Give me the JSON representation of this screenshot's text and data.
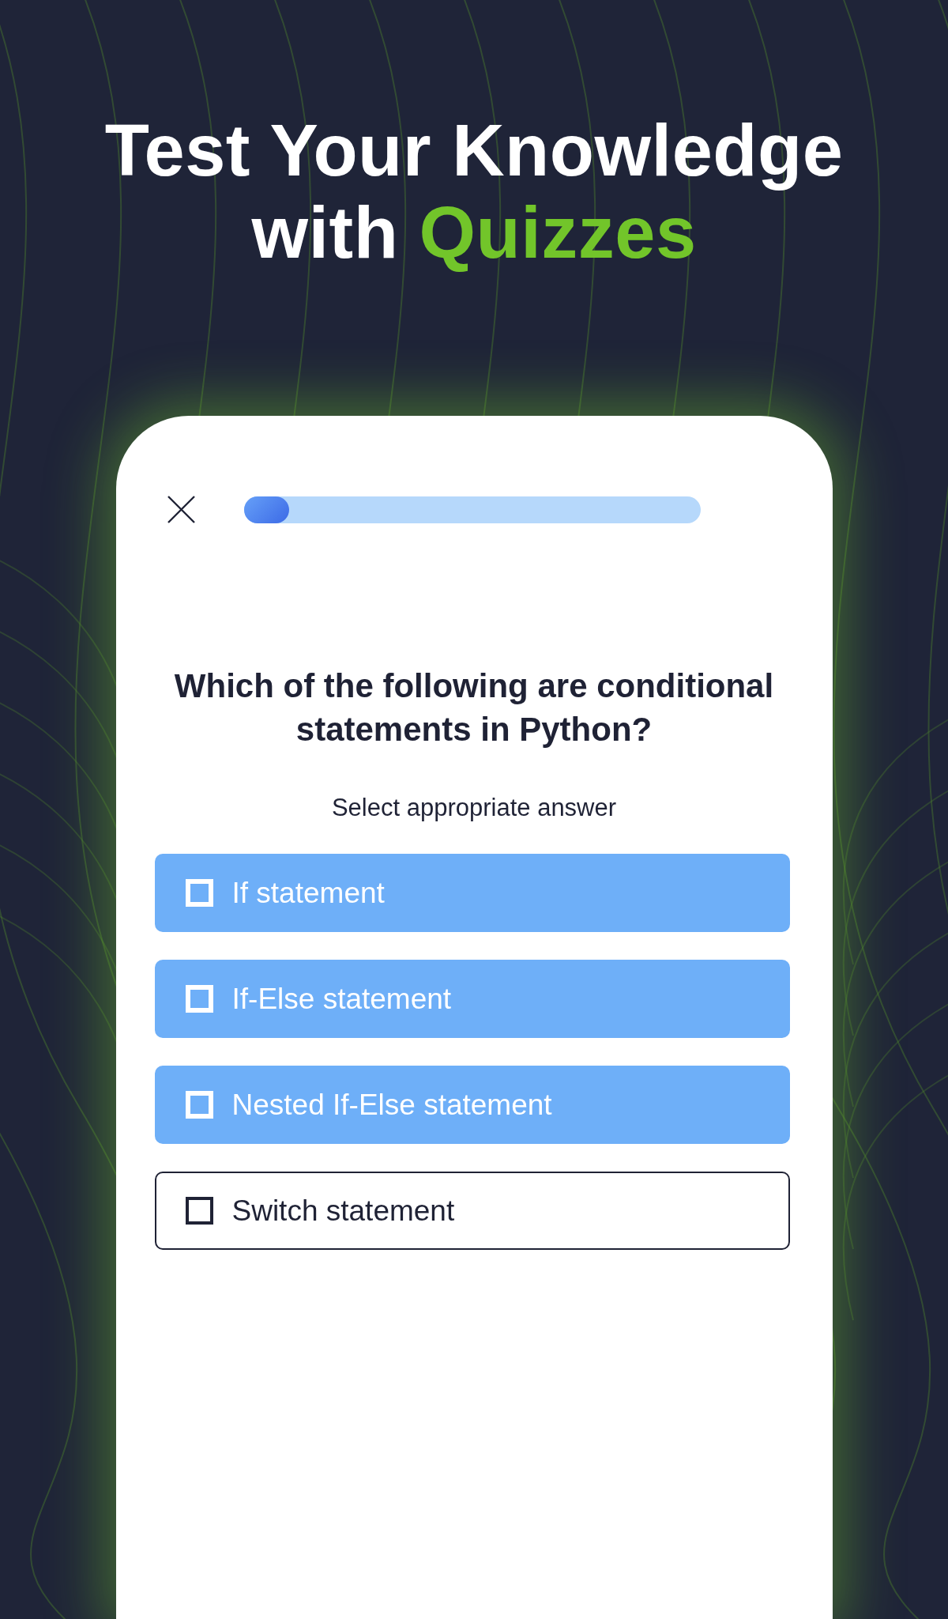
{
  "headline": {
    "text": "Test Your Knowledge with",
    "highlight": "Quizzes"
  },
  "quiz": {
    "progress": {
      "level": 0.1
    },
    "question": "Which of the following are conditional statements in Python?",
    "instruction": "Select appropriate answer",
    "options": [
      {
        "label": "If statement",
        "selected": true
      },
      {
        "label": "If-Else statement",
        "selected": true
      },
      {
        "label": "Nested If-Else statement",
        "selected": true
      },
      {
        "label": "Switch statement",
        "selected": false
      }
    ]
  }
}
